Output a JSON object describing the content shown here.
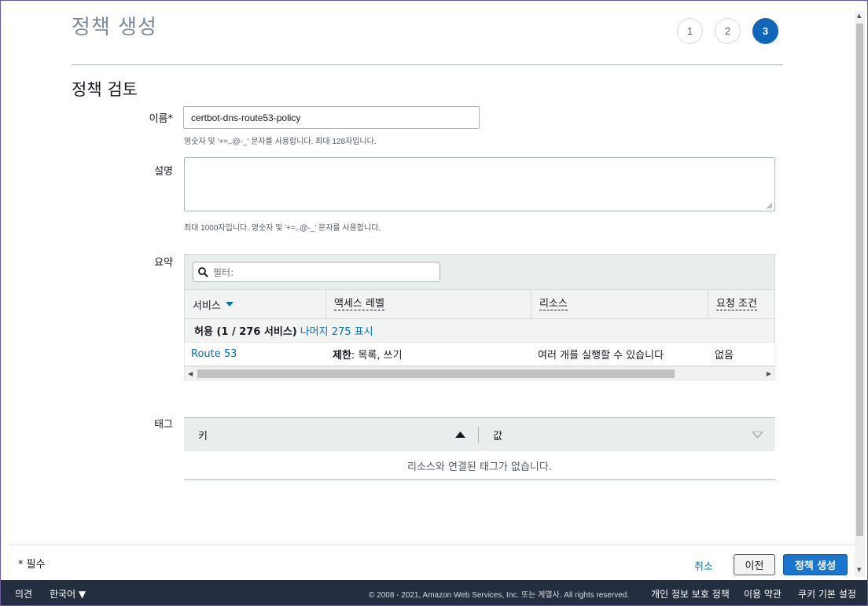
{
  "page": {
    "title": "정책 생성"
  },
  "steps": [
    "1",
    "2",
    "3"
  ],
  "active_step": 3,
  "section": {
    "title": "정책 검토"
  },
  "form": {
    "name_label": "이름*",
    "name_value": "certbot-dns-route53-policy",
    "name_hint": "영숫자 및 '+=,.@-_' 문자를 사용합니다. 최대 128자입니다.",
    "desc_label": "설명",
    "desc_value": "",
    "desc_hint": "최대 1000자입니다. 영숫자 및 '+=,.@-_' 문자를 사용합니다."
  },
  "summary": {
    "label": "요약",
    "filter_placeholder": "필터:",
    "columns": [
      "서비스",
      "액세스 레벨",
      "리소스",
      "요청 조건"
    ],
    "group": {
      "text": "허용 (1 / 276 서비스)",
      "link": "나머지 275 표시"
    },
    "rows": [
      {
        "service": "Route 53",
        "access_bold": "제한",
        "access_rest": ": 목록, 쓰기",
        "resource": "여러 개를 실행할 수 있습니다",
        "condition": "없음"
      }
    ]
  },
  "tags": {
    "label": "태그",
    "key_header": "키",
    "value_header": "값",
    "empty": "리소스와 연결된 태그가 없습니다."
  },
  "footer": {
    "required": "* 필수",
    "cancel": "취소",
    "previous": "이전",
    "create": "정책 생성"
  },
  "bottom_bar": {
    "feedback": "의견",
    "language": "한국어 ▼",
    "copyright": "© 2008 - 2021, Amazon Web Services, Inc. 또는 계열사. All rights reserved.",
    "privacy": "개인 정보 보호 정책",
    "terms": "이용 약관",
    "cookies": "쿠키 기본 설정"
  },
  "colors": {
    "accent": "#1166bb",
    "link": "#0073bb",
    "bottom_bar": "#232f3e"
  }
}
